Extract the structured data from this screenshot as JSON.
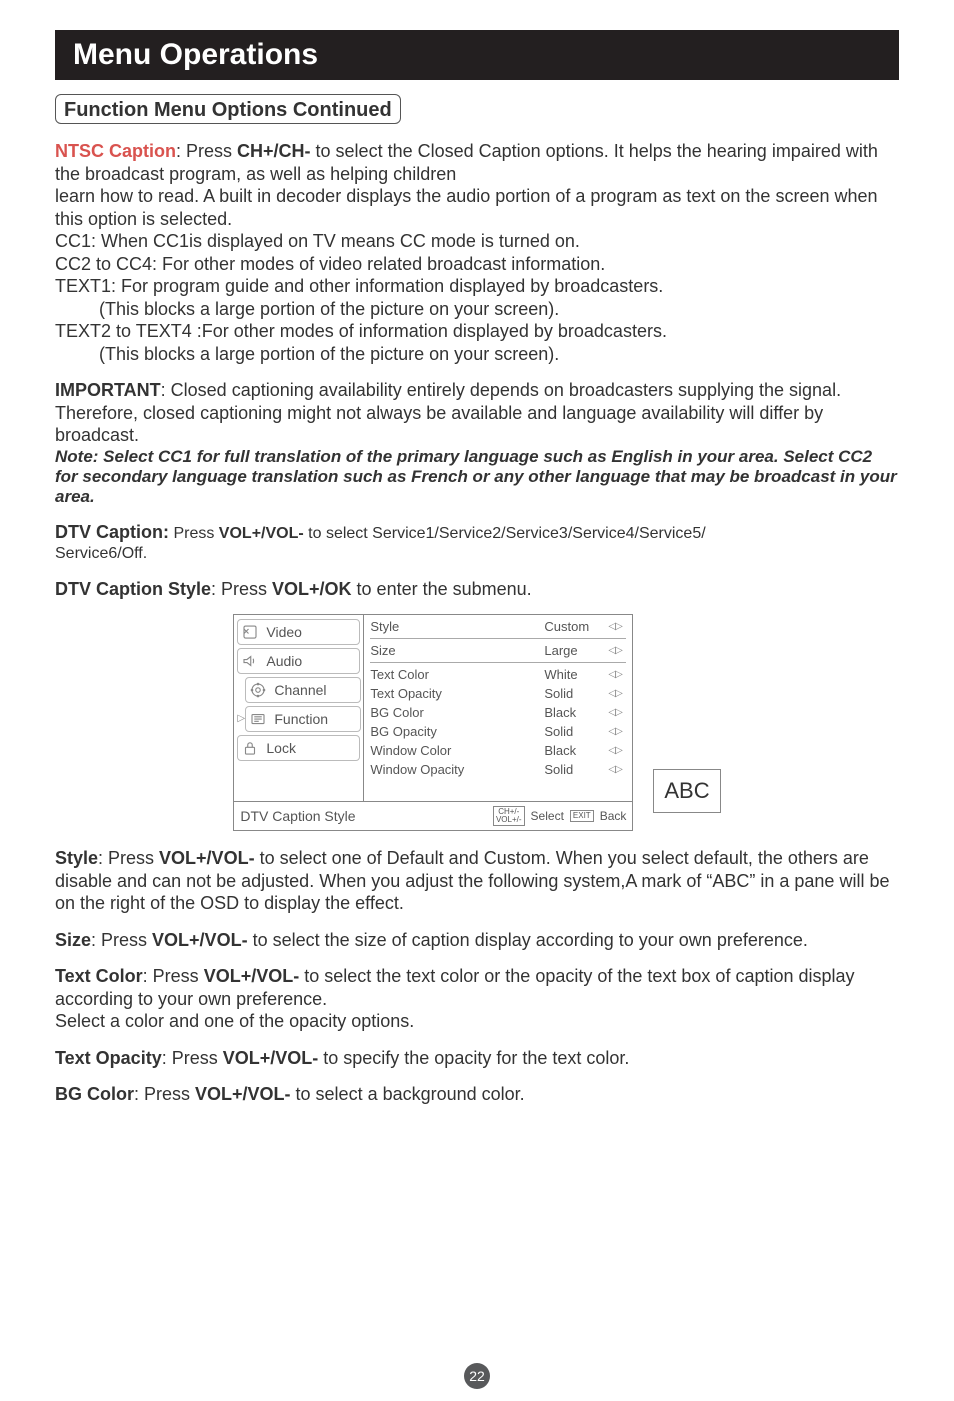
{
  "banner": "Menu Operations",
  "heading": "Function Menu Options Continued",
  "ntsc": {
    "label": "NTSC Caption",
    "after": ": Press ",
    "key": "CH+/CH-",
    "rest1": " to select the Closed Caption options.  It helps the hearing impaired with the broadcast program, as well as helping children",
    "rest2": "learn how to read.  A built in decoder displays the audio portion of a program as text on the screen when this  option is selected."
  },
  "cc1": "CC1:  When CC1is displayed on TV means CC mode is turned on.",
  "cc2": "CC2 to CC4: For other modes of video related broadcast information.",
  "text1a": "TEXT1: For program guide and other information displayed by broadcasters.",
  "text1b": "(This blocks a large portion of the picture on your screen).",
  "text2a": "TEXT2 to TEXT4 :For other modes of information displayed by broadcasters.",
  "text2b": "(This blocks a large portion of the picture on your screen).",
  "important": {
    "label": "IMPORTANT",
    "text": ": Closed captioning availability entirely depends on broadcasters supplying the signal. Therefore, closed captioning might not always be available and language availability will differ by broadcast."
  },
  "note": "Note: Select CC1 for full translation of the primary language such as English in your area. Select CC2 for secondary language translation such as French  or any other language that may be broadcast in your area.",
  "dtv_caption": {
    "label": "DTV Caption:",
    "mid": " Press ",
    "key": "VOL+/VOL-",
    "rest": " to select Service1/Service2/Service3/Service4/Service5/",
    "rest2": "Service6/Off."
  },
  "dtv_style_line": {
    "label": "DTV Caption Style",
    "mid": ": Press ",
    "key": "VOL+/OK",
    "rest": " to enter the submenu."
  },
  "osd": {
    "tabs": [
      "Video",
      "Audio",
      "Channel",
      "Function",
      "Lock"
    ],
    "rows": [
      {
        "lab": "Style",
        "val": "Custom"
      },
      {
        "lab": "Size",
        "val": "Large"
      },
      {
        "lab": "Text Color",
        "val": "White"
      },
      {
        "lab": "Text Opacity",
        "val": "Solid"
      },
      {
        "lab": "BG Color",
        "val": "Black"
      },
      {
        "lab": "BG Opacity",
        "val": "Solid"
      },
      {
        "lab": "Window Color",
        "val": "Black"
      },
      {
        "lab": "Window Opacity",
        "val": "Solid"
      }
    ],
    "footer_title": "DTV Caption Style",
    "footer_key1a": "CH+/-",
    "footer_key1b": "VOL+/-",
    "footer_select": "Select",
    "footer_exit": "EXIT",
    "footer_back": "Back",
    "abc": "ABC"
  },
  "style_p": {
    "label": "Style",
    "mid": ": Press ",
    "key": "VOL+/VOL-",
    "rest": " to select one of Default and Custom. When you select default, the others are disable and can not be adjusted. When you adjust the following system,A mark of   “ABC” in a pane will be on the right of the OSD to display the effect."
  },
  "size_p": {
    "label": "Size",
    "mid": ": Press ",
    "key": "VOL+/VOL-",
    "rest": " to select the size of caption display according to your own preference."
  },
  "textcolor_p": {
    "label": "Text Color",
    "mid": ": Press ",
    "key": "VOL+/VOL-",
    "rest": " to select the text color or the opacity of the text box of caption display according to your own preference.",
    "line2": "Select a color and one of the opacity options."
  },
  "textopacity_p": {
    "label": "Text Opacity",
    "mid": ": Press ",
    "key": "VOL+/VOL-",
    "rest": " to specify the opacity for the text color."
  },
  "bgcolor_p": {
    "label": "BG Color",
    "mid": ": Press ",
    "key": "VOL+/VOL-",
    "rest": " to select a background color."
  },
  "page_num": "22",
  "glyph_lr": "◁▷"
}
